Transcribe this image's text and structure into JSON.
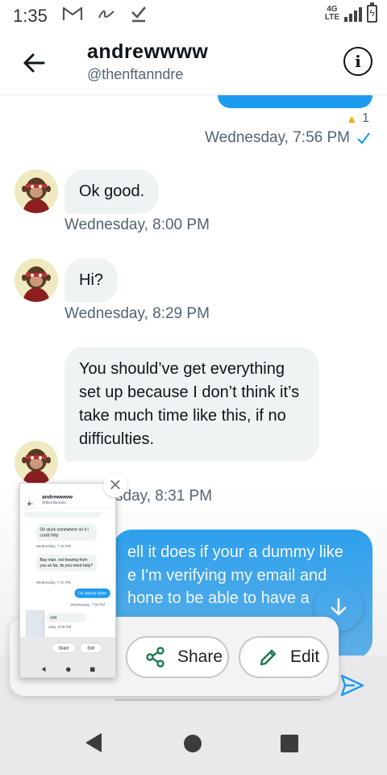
{
  "status_bar": {
    "time": "1:35",
    "network_top": "4G",
    "network_bottom": "LTE"
  },
  "header": {
    "name": "andrewwww",
    "handle": "@thenftanndre"
  },
  "messages": {
    "sent_reaction_count": "1",
    "sent_timestamp": "Wednesday, 7:56 PM",
    "received": [
      {
        "text": "Ok good.",
        "timestamp": "Wednesday, 8:00 PM"
      },
      {
        "text": "Hi?",
        "timestamp": "Wednesday, 8:29 PM"
      },
      {
        "text": "You should’ve get everything set up because I don’t think it’s take much time like this, if no difficulties.",
        "timestamp_visible": "sday, 8:31 PM"
      }
    ],
    "sent_partial": [
      "ell it does if your a dummy like",
      "e I'm verifying my email and",
      "hone to be able to have a"
    ]
  },
  "screenshot_toolbar": {
    "share_label": "Share",
    "edit_label": "Edit"
  },
  "thumbnail": {
    "name": "andrewwww",
    "handle": "@thenftanndre",
    "msg1": "Ok stuck somewhere on it I could help",
    "ts1": "Wednesday, 7:43 PM",
    "msg2": "Bay man, not hearing from you so far, do you need help?",
    "ts2": "Wednesday, 7:47 PM",
    "sent": "I'm almost done",
    "ts_sent": "Wednesday, 7:56 PM",
    "msg3": "ood",
    "ts3": "sday, 8:00 PM",
    "share": "Share",
    "edit": "Edit"
  },
  "colors": {
    "accent": "#1d9bf0",
    "bubble_in": "#eff3f4",
    "secondary_text": "#536471"
  }
}
